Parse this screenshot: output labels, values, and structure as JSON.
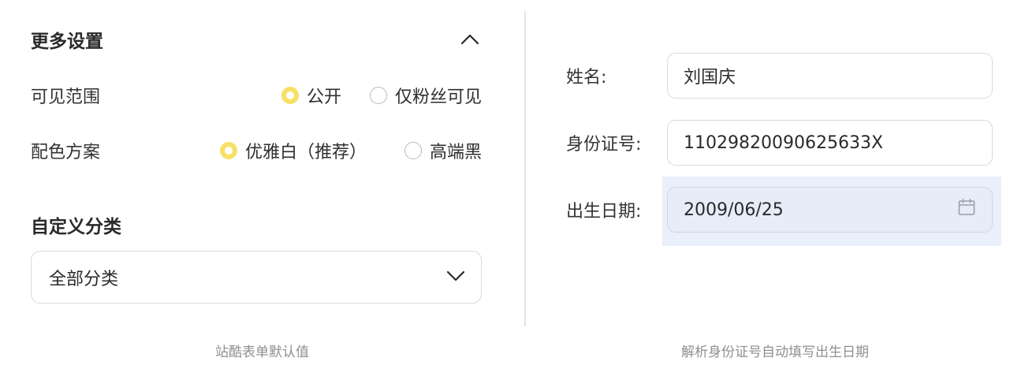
{
  "settings": {
    "title": "更多设置",
    "visibility": {
      "label": "可见范围",
      "options": [
        "公开",
        "仅粉丝可见"
      ],
      "selected": "公开"
    },
    "color_scheme": {
      "label": "配色方案",
      "options": [
        "优雅白（推荐）",
        "高端黑"
      ],
      "selected": "优雅白（推荐）"
    },
    "category": {
      "label": "自定义分类",
      "value": "全部分类"
    }
  },
  "form": {
    "name": {
      "label": "姓名:",
      "value": "刘国庆"
    },
    "id_number": {
      "label": "身份证号:",
      "value": "11029820090625633X"
    },
    "birthdate": {
      "label": "出生日期:",
      "value": "2009/06/25"
    }
  },
  "captions": {
    "left": "站酷表单默认值",
    "right": "解析身份证号自动填写出生日期"
  },
  "colors": {
    "radio_checked": "#f7e065",
    "focus_bg": "#e9f0fb"
  },
  "icons": [
    "chevron-up-icon",
    "chevron-down-icon",
    "calendar-icon"
  ]
}
